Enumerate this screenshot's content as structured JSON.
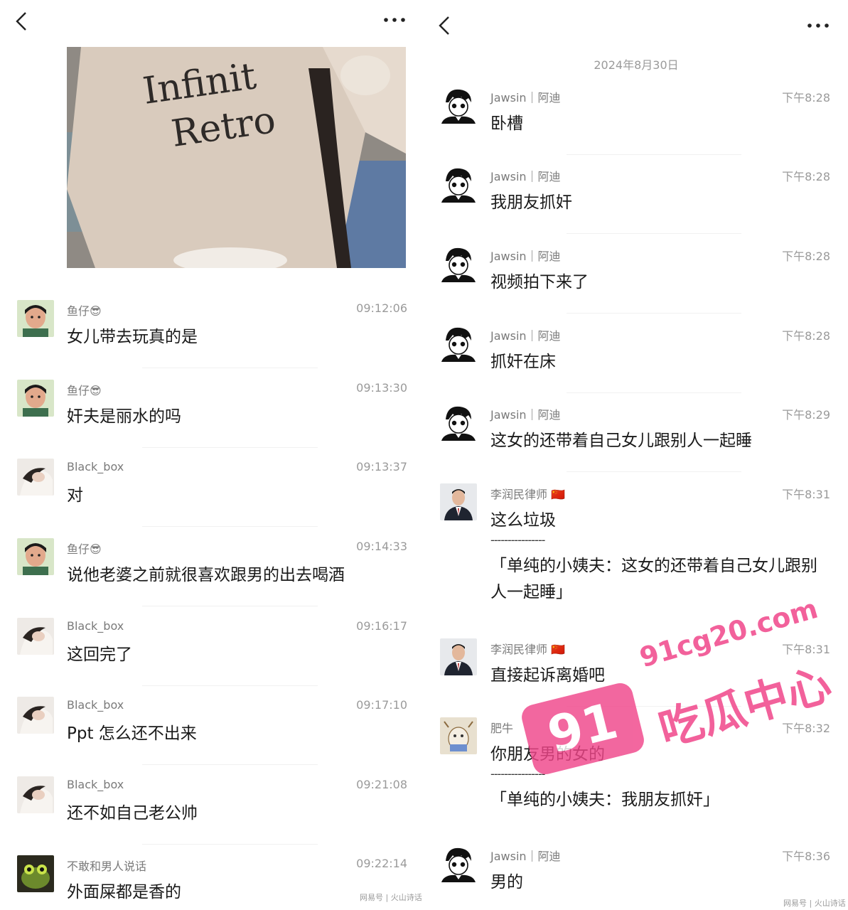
{
  "left": {
    "messages": [
      {
        "sender": "鱼仔😎",
        "time": "09:12:06",
        "text": "女儿带去玩真的是"
      },
      {
        "sender": "鱼仔😎",
        "time": "09:13:30",
        "text": "奸夫是丽水的吗"
      },
      {
        "sender": "Black_box",
        "time": "09:13:37",
        "text": "对"
      },
      {
        "sender": "鱼仔😎",
        "time": "09:14:33",
        "text": "说他老婆之前就很喜欢跟男的出去喝酒"
      },
      {
        "sender": "Black_box",
        "time": "09:16:17",
        "text": "这回完了"
      },
      {
        "sender": "Black_box",
        "time": "09:17:10",
        "text": "Ppt 怎么还不出来"
      },
      {
        "sender": "Black_box",
        "time": "09:21:08",
        "text": "还不如自己老公帅"
      },
      {
        "sender": "不敢和男人说话",
        "time": "09:22:14",
        "text": "外面屎都是香的"
      }
    ],
    "footer_mark": "网易号 | 火山诗话"
  },
  "right": {
    "date": "2024年8月30日",
    "messages": [
      {
        "sender": "Jawsin｜阿迪",
        "time": "下午8:28",
        "text": "卧槽"
      },
      {
        "sender": "Jawsin｜阿迪",
        "time": "下午8:28",
        "text": "我朋友抓奸"
      },
      {
        "sender": "Jawsin｜阿迪",
        "time": "下午8:28",
        "text": "视频拍下来了"
      },
      {
        "sender": "Jawsin｜阿迪",
        "time": "下午8:28",
        "text": "抓奸在床"
      },
      {
        "sender": "Jawsin｜阿迪",
        "time": "下午8:29",
        "text": "这女的还带着自己女儿跟别人一起睡"
      },
      {
        "sender": "李润民律师 🇨🇳",
        "time": "下午8:31",
        "text": "这么垃圾",
        "quote_dash": "----------------",
        "quote": "「单纯的小姨夫：这女的还带着自己女儿跟别人一起睡」"
      },
      {
        "sender": "李润民律师 🇨🇳",
        "time": "下午8:31",
        "text": "直接起诉离婚吧"
      },
      {
        "sender": "肥牛",
        "time": "下午8:32",
        "text": "你朋友男的女的",
        "quote_dash": "----------------",
        "quote": "「单纯的小姨夫：我朋友抓奸」"
      },
      {
        "sender": "Jawsin｜阿迪",
        "time": "下午8:36",
        "text": "男的"
      }
    ],
    "footer_mark": "网易号 | 火山诗话"
  },
  "watermark": {
    "badge": "91",
    "url": "91cg20.com",
    "name": "吃瓜中心"
  },
  "colors": {
    "watermark": "#f0468a",
    "meta_text": "#9a9a9a"
  }
}
